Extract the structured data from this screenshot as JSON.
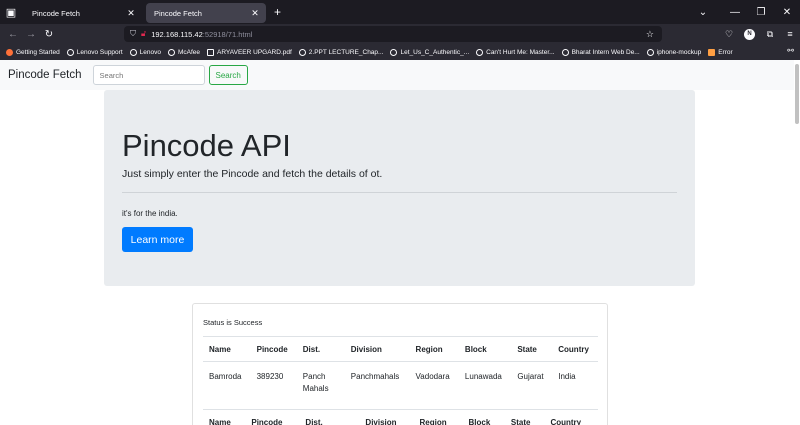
{
  "browser": {
    "tabs": [
      {
        "title": "Pincode Fetch",
        "active": false
      },
      {
        "title": "Pincode Fetch",
        "active": true
      }
    ],
    "url_host": "192.168.115.42",
    "url_path": ":52918/71.html",
    "bookmarks": [
      {
        "label": "Getting Started",
        "icon": "firefox-icon"
      },
      {
        "label": "Lenovo Support",
        "icon": "globe-icon"
      },
      {
        "label": "Lenovo",
        "icon": "globe-icon"
      },
      {
        "label": "McAfee",
        "icon": "globe-icon"
      },
      {
        "label": "ARYAVEER UPGARD.pdf",
        "icon": "pdf-icon"
      },
      {
        "label": "2.PPT LECTURE_Chap...",
        "icon": "globe-icon"
      },
      {
        "label": "Let_Us_C_Authentic_...",
        "icon": "globe-icon"
      },
      {
        "label": "Can't Hurt Me: Master...",
        "icon": "globe-icon"
      },
      {
        "label": "Bharat Intern Web De...",
        "icon": "globe-icon"
      },
      {
        "label": "iphone-mockup",
        "icon": "globe-icon"
      },
      {
        "label": "Error",
        "icon": "error-icon"
      }
    ],
    "profile_initial": "N"
  },
  "site": {
    "brand": "Pincode Fetch",
    "search_placeholder": "Search",
    "search_button": "Search"
  },
  "jumbotron": {
    "title": "Pincode API",
    "lead": "Just simply enter the Pincode and fetch the details of ot.",
    "note": "it's for the india.",
    "button": "Learn more"
  },
  "results": {
    "status": "Status is Success",
    "columns": [
      "Name",
      "Pincode",
      "Dist.",
      "Division",
      "Region",
      "Block",
      "State",
      "Country"
    ],
    "rows": [
      [
        "Bamroda",
        "389230",
        "Panch Mahals",
        "Panchmahals",
        "Vadodara",
        "Lunawada",
        "Gujarat",
        "India"
      ]
    ]
  },
  "colors": {
    "primary": "#007bff",
    "success": "#28a745",
    "jumbotron_bg": "#e9ecef"
  }
}
